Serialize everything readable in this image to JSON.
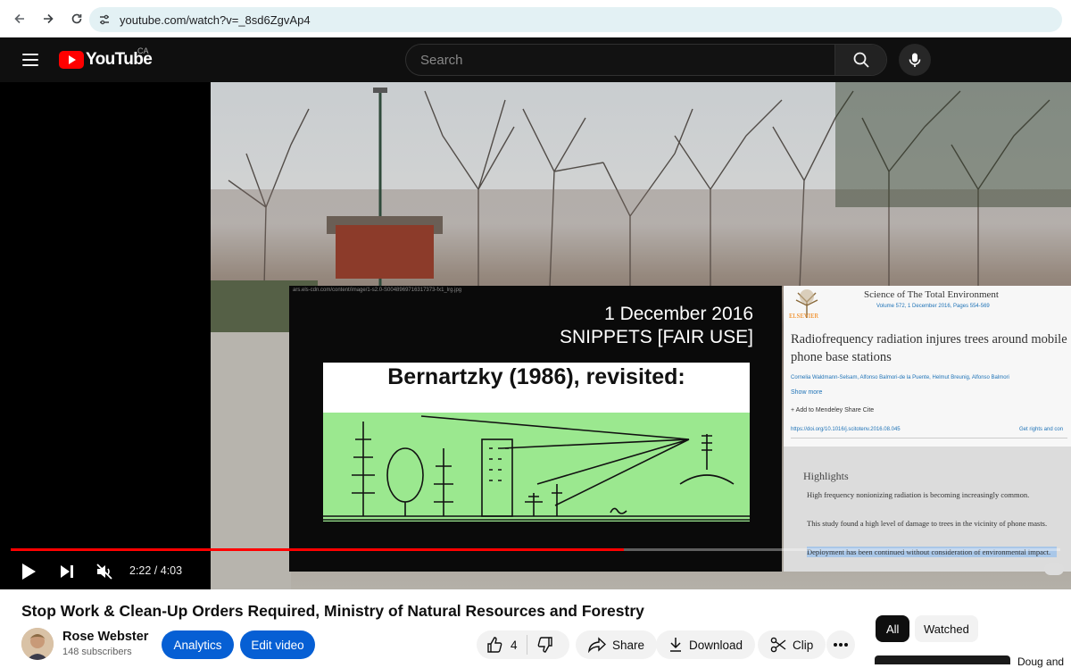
{
  "browser": {
    "url": "youtube.com/watch?v=_8sd6ZgvAp4"
  },
  "masthead": {
    "logo_text": "YouTube",
    "region": "CA",
    "search_placeholder": "Search"
  },
  "video_frame": {
    "slide_date": "1 December 2016",
    "slide_snippets": "SNIPPETS [FAIR USE]",
    "slide_caption": "Bernartzky (1986), revisited:",
    "slide_url": "ars.els-cdn.com/content/image/1-s2.0-S0048969716317373-fx1_lrg.jpg",
    "paper": {
      "publisher": "ELSEVIER",
      "journal": "Science of The Total Environment",
      "volume": "Volume 572, 1 December 2016, Pages 554-569",
      "title": "Radiofrequency radiation injures trees around mobile phone base stations",
      "authors": "Cornelia Waldmann-Selsam, Alfonso Balmori-de la Puente, Helmut Breunig, Alfonso Balmori",
      "show_more": "Show more",
      "actions": "+ Add to Mendeley   Share   Cite",
      "doi": "https://doi.org/10.1016/j.scitotenv.2016.08.045",
      "rights": "Get rights and con",
      "highlights_title": "Highlights",
      "bullets": [
        "High frequency nonionizing radiation is becoming increasingly common.",
        "This study found a high level of damage to trees in the vicinity of phone masts.",
        "Deployment has been continued without consideration of environmental impact."
      ]
    }
  },
  "player": {
    "time": "2:22 / 4:03",
    "progress_fraction": 0.584
  },
  "video": {
    "title": "Stop Work & Clean-Up Orders Required, Ministry of Natural Resources and Forestry",
    "channel": "Rose Webster",
    "subscribers": "148 subscribers",
    "analytics_label": "Analytics",
    "edit_label": "Edit video",
    "likes": "4",
    "share_label": "Share",
    "download_label": "Download",
    "clip_label": "Clip"
  },
  "sidebar": {
    "chips": [
      "All",
      "Watched"
    ],
    "next_title_fragment": "Doug and"
  },
  "colors": {
    "brand_red": "#ff0000",
    "accent_blue": "#065fd4",
    "masthead_bg": "#0f0f0f"
  }
}
